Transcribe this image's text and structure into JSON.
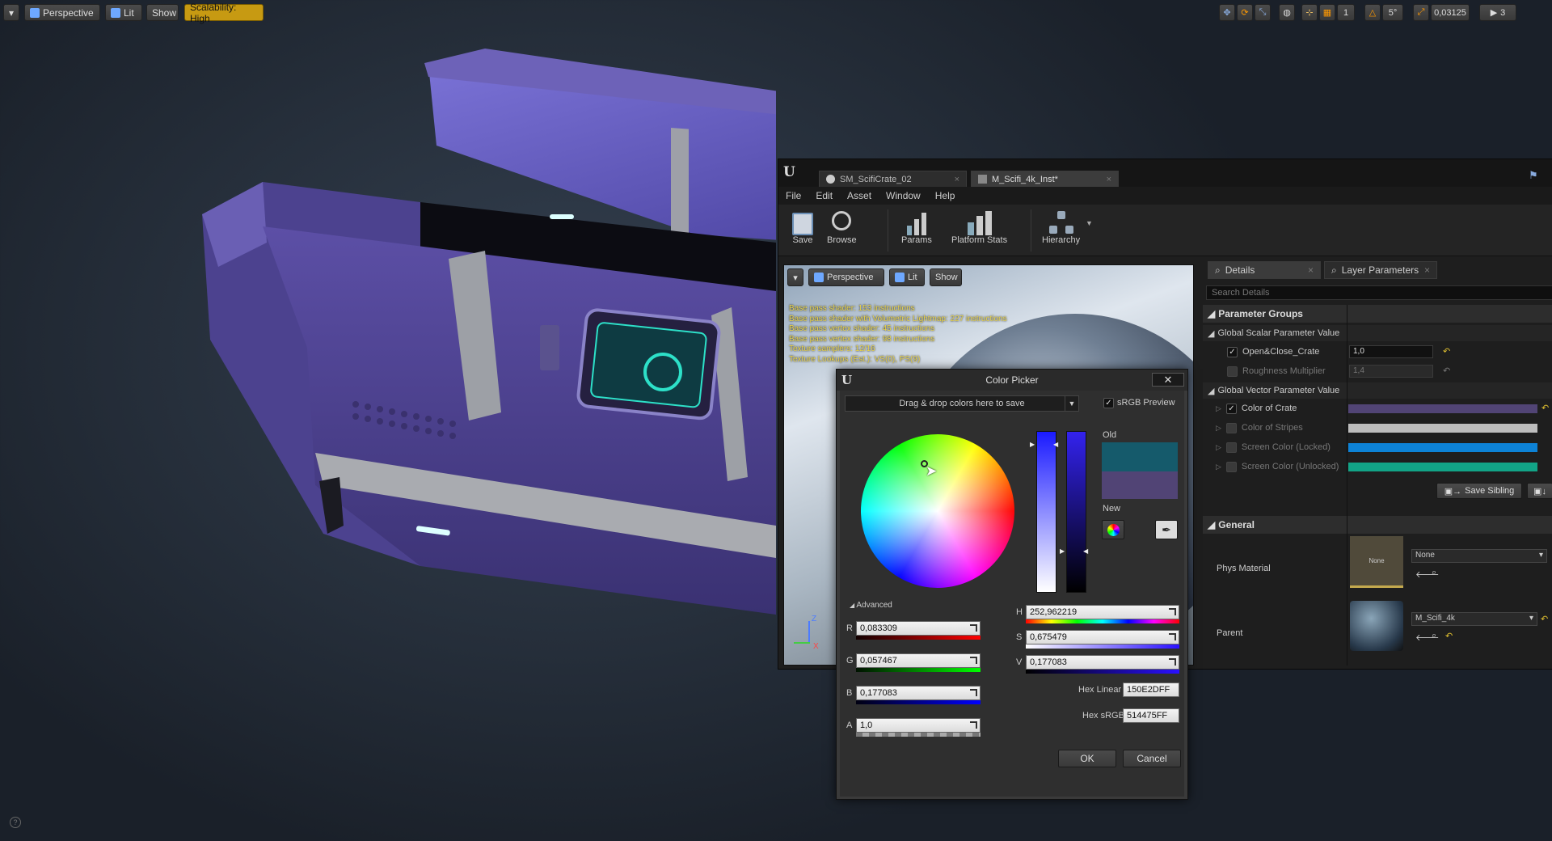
{
  "viewport_toolbar": {
    "perspective": "Perspective",
    "lit": "Lit",
    "show": "Show",
    "scalability": "Scalability: High",
    "right": {
      "grid_value": "1",
      "angle_value": "5°",
      "scale_value": "0,03125",
      "camera_speed": "3"
    }
  },
  "editor": {
    "tabs": [
      {
        "label": "SM_ScifiCrate_02"
      },
      {
        "label": "M_Scifi_4k_Inst*"
      }
    ],
    "menu": [
      "File",
      "Edit",
      "Asset",
      "Window",
      "Help"
    ],
    "toolbar": {
      "save": "Save",
      "browse": "Browse",
      "params": "Params",
      "platform_stats": "Platform Stats",
      "hierarchy": "Hierarchy"
    },
    "preview": {
      "perspective": "Perspective",
      "lit": "Lit",
      "show": "Show",
      "stats": [
        "Base pass shader: 153 instructions",
        "Base pass shader with Volumetric Lightmap: 227 instructions",
        "Base pass vertex shader: 45 instructions",
        "Base pass vertex shader: 98 instructions",
        "Texture samplers: 12/16",
        "Texture Lookups (Est.): VS(0), PS(9)"
      ]
    },
    "details": {
      "tab_details": "Details",
      "tab_layers": "Layer Parameters",
      "search_placeholder": "Search Details",
      "parameter_groups": "Parameter Groups",
      "scalar_group": "Global Scalar Parameter Value",
      "scalar_params": [
        {
          "name": "Open&Close_Crate",
          "value": "1,0",
          "enabled": true
        },
        {
          "name": "Roughness Multiplier",
          "value": "1,4",
          "enabled": false
        }
      ],
      "vector_group": "Global Vector Parameter Value",
      "vector_params": [
        {
          "name": "Color of Crate",
          "enabled": true,
          "color": "#514475"
        },
        {
          "name": "Color of Stripes",
          "enabled": false,
          "color": "#bdbdbd"
        },
        {
          "name": "Screen Color (Locked)",
          "enabled": false,
          "color": "#0d82d6"
        },
        {
          "name": "Screen Color (Unlocked)",
          "enabled": false,
          "color": "#12a487"
        }
      ],
      "save_sibling": "Save Sibling",
      "general": "General",
      "phys_material_label": "Phys Material",
      "phys_material_thumb": "None",
      "phys_material_value": "None",
      "parent_label": "Parent",
      "parent_value": "M_Scifi_4k"
    }
  },
  "color_picker": {
    "title": "Color Picker",
    "drag_drop": "Drag & drop colors here to save",
    "srgb_preview": "sRGB Preview",
    "old_label": "Old",
    "new_label": "New",
    "old_color": "#155a6b",
    "new_color": "#514475",
    "advanced": "Advanced",
    "r_label": "R",
    "r_value": "0,083309",
    "g_label": "G",
    "g_value": "0,057467",
    "b_label": "B",
    "b_value": "0,177083",
    "a_label": "A",
    "a_value": "1,0",
    "h_label": "H",
    "h_value": "252,962219",
    "s_label": "S",
    "s_value": "0,675479",
    "v_label": "V",
    "v_value": "0,177083",
    "hex_linear_label": "Hex Linear",
    "hex_linear_value": "150E2DFF",
    "hex_srgb_label": "Hex sRGB",
    "hex_srgb_value": "514475FF",
    "ok": "OK",
    "cancel": "Cancel"
  }
}
